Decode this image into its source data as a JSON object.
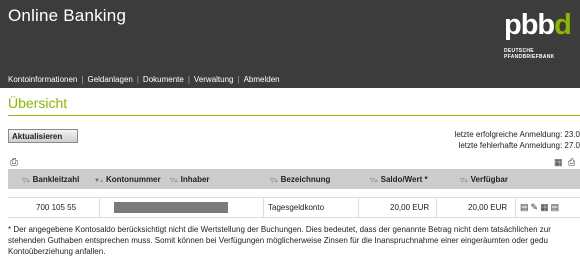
{
  "header": {
    "app_title": "Online Banking",
    "logo": {
      "main": "pbb",
      "tail": "d",
      "sub_line1": "DEUTSCHE",
      "sub_line2": "PFANDBRIEFBANK"
    },
    "nav": [
      "Kontoinformationen",
      "Geldanlagen",
      "Dokumente",
      "Verwaltung",
      "Abmelden"
    ]
  },
  "page": {
    "title": "Übersicht",
    "refresh_button": "Aktualisieren",
    "last_login_ok": "letzte erfolgreiche Anmeldung: 23.0",
    "last_login_failed": "letzte fehlerhafte Anmeldung: 27.0"
  },
  "table": {
    "columns": [
      "Bankleitzahl",
      "Kontonummer",
      "Inhaber",
      "Bezeichnung",
      "Saldo/Wert *",
      "Verfügbar"
    ],
    "rows": [
      {
        "bankleitzahl": "700 105 55",
        "kontonummer": "",
        "inhaber": "",
        "bezeichnung": "Tagesgeldkonto",
        "saldo": "20,00 EUR",
        "verfuegbar": "20,00 EUR"
      }
    ]
  },
  "footnote": {
    "line1": "* Der angegebene Kontosaldo berücksichtigt nicht die Wertstellung der Buchungen. Dies bedeutet, dass der genannte Betrag nicht dem tatsächlichen zur",
    "line2": "stehenden Guthaben entsprechen muss. Somit können bei Verfügungen möglicherweise Zinsen für die Inanspruchnahme einer eingeräumten oder gedu",
    "line3": "Kontoüberziehung anfallen."
  },
  "colors": {
    "header_bg": "#3c3c3c",
    "accent": "#8ab800",
    "table_head_bg": "#cccccc"
  }
}
